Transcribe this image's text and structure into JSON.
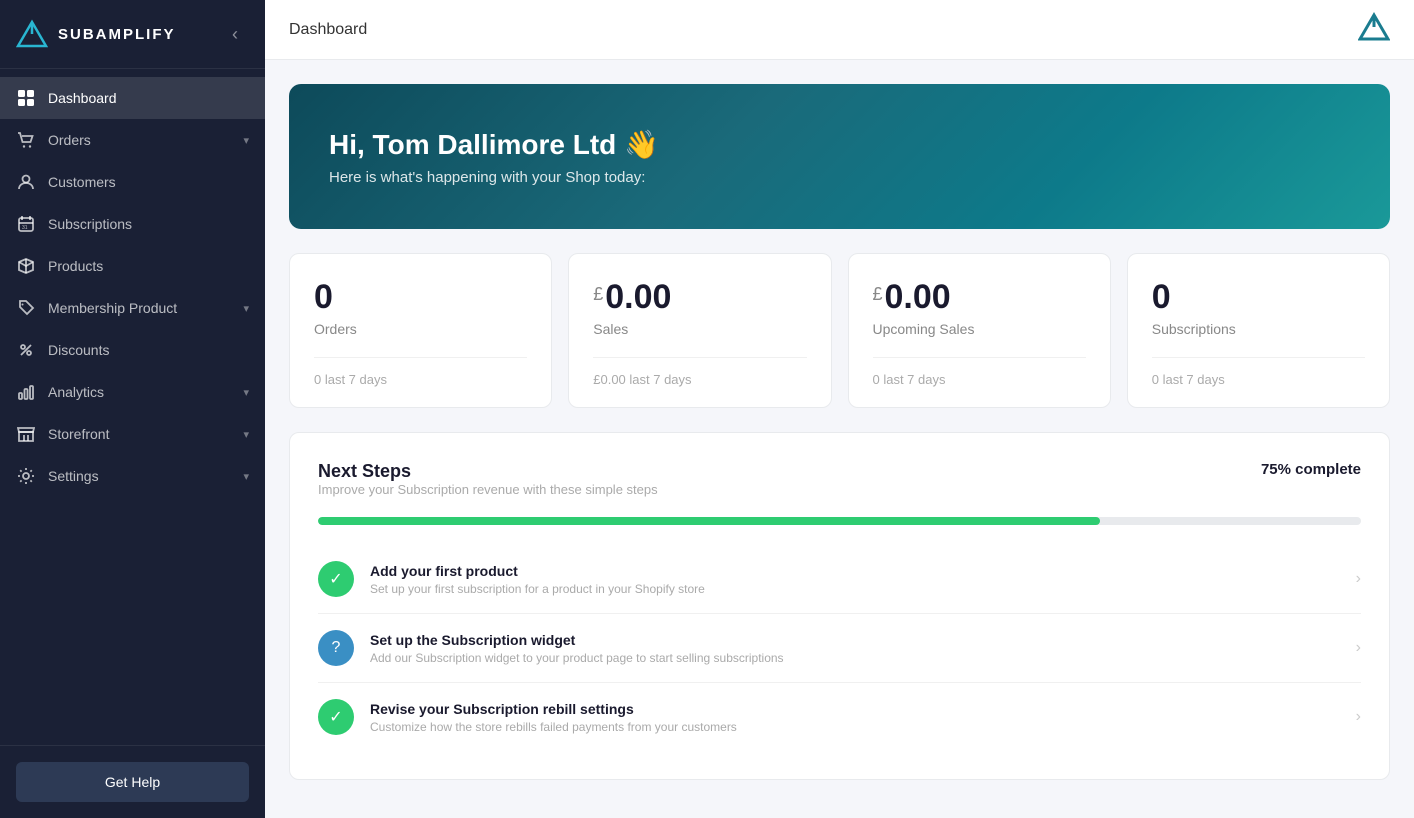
{
  "app": {
    "name": "SUBAMPLIFY"
  },
  "sidebar": {
    "toggle_label": "‹",
    "items": [
      {
        "id": "dashboard",
        "label": "Dashboard",
        "icon": "grid",
        "active": true,
        "hasChevron": false
      },
      {
        "id": "orders",
        "label": "Orders",
        "icon": "cart",
        "active": false,
        "hasChevron": true
      },
      {
        "id": "customers",
        "label": "Customers",
        "icon": "person",
        "active": false,
        "hasChevron": false
      },
      {
        "id": "subscriptions",
        "label": "Subscriptions",
        "icon": "calendar",
        "active": false,
        "hasChevron": false
      },
      {
        "id": "products",
        "label": "Products",
        "icon": "box",
        "active": false,
        "hasChevron": false
      },
      {
        "id": "membership-product",
        "label": "Membership Product",
        "icon": "tag",
        "active": false,
        "hasChevron": true
      },
      {
        "id": "discounts",
        "label": "Discounts",
        "icon": "discount",
        "active": false,
        "hasChevron": false
      },
      {
        "id": "analytics",
        "label": "Analytics",
        "icon": "chart",
        "active": false,
        "hasChevron": true
      },
      {
        "id": "storefront",
        "label": "Storefront",
        "icon": "store",
        "active": false,
        "hasChevron": true
      },
      {
        "id": "settings",
        "label": "Settings",
        "icon": "gear",
        "active": false,
        "hasChevron": true
      }
    ],
    "footer": {
      "button_label": "Get Help"
    }
  },
  "topbar": {
    "title": "Dashboard"
  },
  "hero": {
    "title": "Hi, Tom Dallimore Ltd 👋",
    "subtitle": "Here is what's happening with your Shop today:"
  },
  "stats": [
    {
      "value": "0",
      "currency": "",
      "label": "Orders",
      "sub_label": "0 last 7 days"
    },
    {
      "value": "0.00",
      "currency": "£",
      "label": "Sales",
      "sub_label": "£0.00 last 7 days"
    },
    {
      "value": "0.00",
      "currency": "£",
      "label": "Upcoming Sales",
      "sub_label": "0 last 7 days"
    },
    {
      "value": "0",
      "currency": "",
      "label": "Subscriptions",
      "sub_label": "0 last 7 days"
    }
  ],
  "next_steps": {
    "title": "Next Steps",
    "subtitle": "Improve your Subscription revenue with these simple steps",
    "completion": "75% complete",
    "progress_pct": 75,
    "steps": [
      {
        "status": "done",
        "title": "Add your first product",
        "desc": "Set up your first subscription for a product in your Shopify store"
      },
      {
        "status": "pending",
        "title": "Set up the Subscription widget",
        "desc": "Add our Subscription widget to your product page to start selling subscriptions"
      },
      {
        "status": "done",
        "title": "Revise your Subscription rebill settings",
        "desc": "Customize how the store rebills failed payments from your customers"
      }
    ]
  }
}
